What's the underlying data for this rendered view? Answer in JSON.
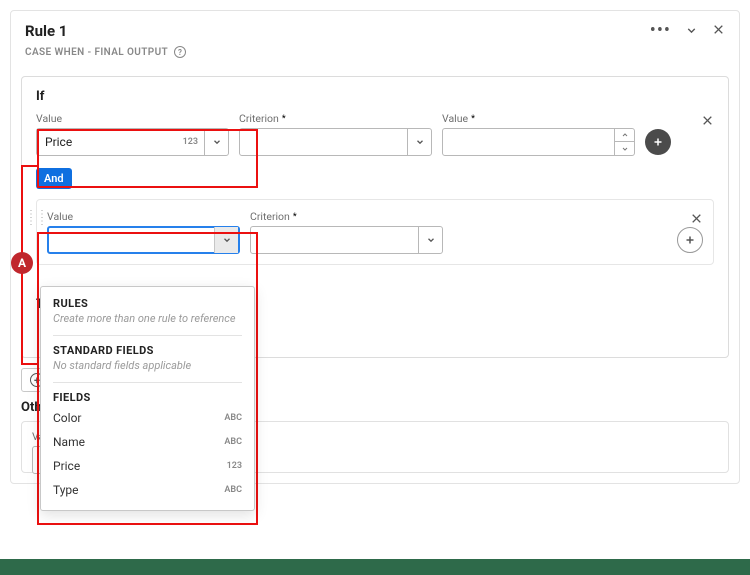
{
  "rule": {
    "title": "Rule 1",
    "subtitle": "CASE WHEN - FINAL OUTPUT"
  },
  "labels": {
    "if": "If",
    "value": "Value",
    "criterion": "Criterion",
    "value2": "Value",
    "and": "And",
    "then": "Then",
    "addRule": "Add rule",
    "otherwise": "Otherwise",
    "valueShort": "Value"
  },
  "cond1": {
    "valueText": "Price",
    "valueTypeBadge": "123"
  },
  "dropdown": {
    "sections": {
      "rules": {
        "title": "RULES",
        "note": "Create more than one rule to reference"
      },
      "standard": {
        "title": "STANDARD FIELDS",
        "note": "No standard fields applicable"
      },
      "fields": {
        "title": "FIELDS",
        "items": [
          {
            "label": "Color",
            "type": "ABC"
          },
          {
            "label": "Name",
            "type": "ABC"
          },
          {
            "label": "Price",
            "type": "123"
          },
          {
            "label": "Type",
            "type": "ABC"
          }
        ]
      }
    }
  },
  "marker": "A"
}
